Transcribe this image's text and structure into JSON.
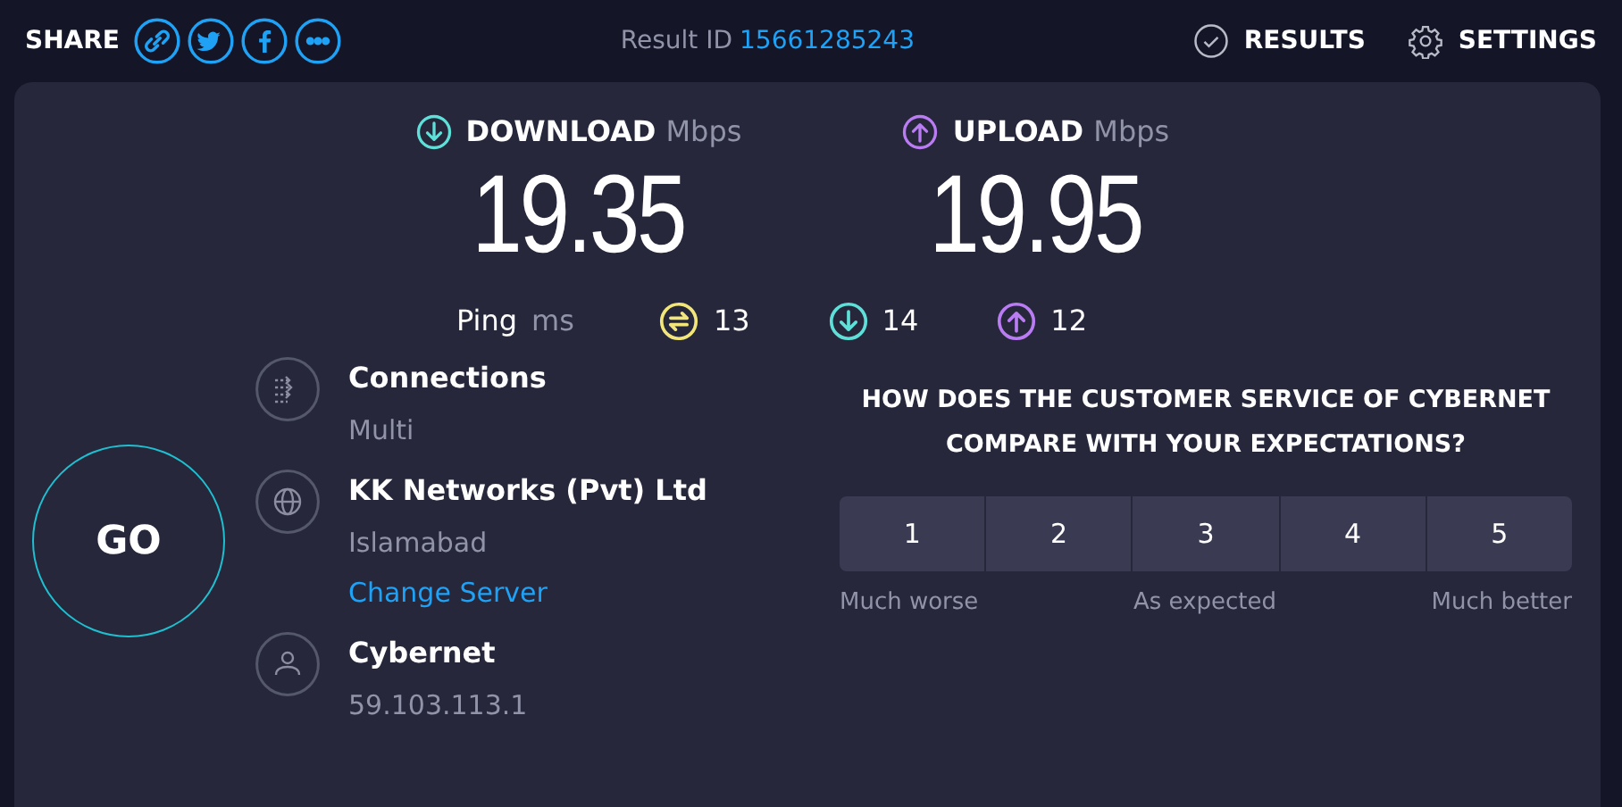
{
  "share": {
    "label": "SHARE",
    "buttons": [
      {
        "kind": "link"
      },
      {
        "kind": "twitter"
      },
      {
        "kind": "facebook"
      },
      {
        "kind": "more"
      }
    ]
  },
  "result_id": {
    "label": "Result ID",
    "value": "15661285243"
  },
  "nav": [
    {
      "kind": "results",
      "label": "RESULTS"
    },
    {
      "kind": "settings",
      "label": "SETTINGS"
    }
  ],
  "speeds": [
    {
      "kind": "download",
      "label": "DOWNLOAD",
      "unit": "Mbps",
      "value": "19.35"
    },
    {
      "kind": "upload",
      "label": "UPLOAD",
      "unit": "Mbps",
      "value": "19.95"
    }
  ],
  "ping": {
    "label": "Ping",
    "unit": "ms",
    "readings": [
      {
        "kind": "idle",
        "value": "13"
      },
      {
        "kind": "download",
        "value": "14"
      },
      {
        "kind": "upload",
        "value": "12"
      }
    ]
  },
  "go_button": "GO",
  "info": [
    {
      "kind": "connections",
      "title": "Connections",
      "detail": "Multi"
    },
    {
      "kind": "server",
      "title": "KK Networks (Pvt) Ltd",
      "detail": "Islamabad",
      "link": "Change Server"
    },
    {
      "kind": "provider",
      "title": "Cybernet",
      "detail": "59.103.113.1"
    }
  ],
  "survey": {
    "question": "HOW DOES THE CUSTOMER SERVICE OF CYBERNET COMPARE WITH YOUR EXPECTATIONS?",
    "options": [
      "1",
      "2",
      "3",
      "4",
      "5"
    ],
    "scale_labels": [
      "Much worse",
      "As expected",
      "Much better"
    ]
  }
}
